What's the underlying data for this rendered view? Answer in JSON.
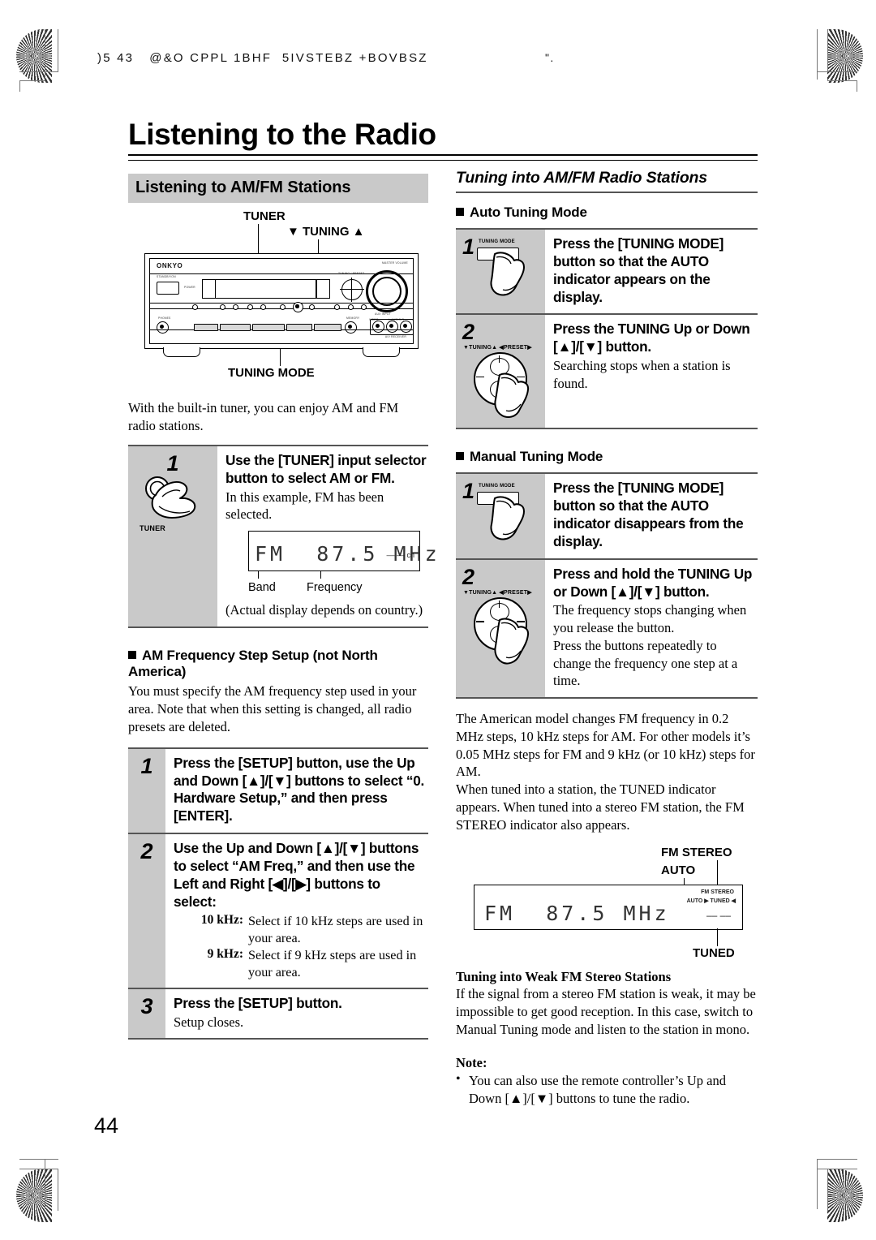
{
  "document": {
    "running_header_left": ")5 43   @&O CPPL 1BHF  5IVSTEBZ +BOVBSZ",
    "running_header_right": "\".",
    "page_number": "44",
    "title": "Listening to the Radio"
  },
  "left_column": {
    "section_heading": "Listening to AM/FM Stations",
    "figure": {
      "label_tuner": "TUNER",
      "label_tuning": "▼ TUNING ▲",
      "label_tuning_mode": "TUNING MODE",
      "brand": "ONKYO",
      "tiny_standby": "STANDBY/ON",
      "tiny_power": "POWER",
      "tiny_master_volume": "MASTER VOLUME",
      "tiny_tuning_preset": "TUNING / PRESET",
      "tiny_phones": "PHONES",
      "tiny_memory": "MEMORY",
      "tiny_aux_input": "AUX INPUT",
      "tiny_video": "VIDEO",
      "tiny_laudio": "L-AUDIO-R",
      "tiny_receiver_model": "A/V RECEIVER"
    },
    "intro_text": "With the built-in tuner, you can enjoy AM and FM radio stations.",
    "steps": [
      {
        "num": "1",
        "button_label": "TUNER",
        "bold": "Use the [TUNER] input selector button to select AM or FM.",
        "plain": "In this example, FM has been selected.",
        "display": {
          "text": "FM  87.5 MHz",
          "right_indicator": "–– –– ch",
          "label_band": "Band",
          "label_frequency": "Frequency"
        },
        "note": "(Actual display depends on country.)"
      }
    ],
    "am_setup": {
      "heading": "AM Frequency Step Setup (not North America)",
      "intro": "You must specify the AM frequency step used in your area. Note that when this setting is changed, all radio presets are deleted.",
      "steps": [
        {
          "num": "1",
          "bold": "Press the [SETUP] button, use the Up and Down [▲]/[▼] buttons to select “0. Hardware Setup,” and then press [ENTER]."
        },
        {
          "num": "2",
          "bold": "Use the Up and Down [▲]/[▼] buttons to select “AM Freq,” and then use the Left and Right [◀]/[▶] buttons to select:",
          "options": [
            {
              "key": "10 kHz:",
              "value": "Select if 10 kHz steps are used in your area."
            },
            {
              "key": "9 kHz:",
              "value": "Select if 9 kHz steps are used in your area."
            }
          ]
        },
        {
          "num": "3",
          "bold": "Press the [SETUP] button.",
          "plain": "Setup closes."
        }
      ]
    }
  },
  "right_column": {
    "section_heading": "Tuning into AM/FM Radio Stations",
    "auto_tuning": {
      "heading": "Auto Tuning Mode",
      "steps": [
        {
          "num": "1",
          "button_label": "TUNING MODE",
          "bold": "Press the [TUNING MODE] button so that the AUTO indicator appears on the display."
        },
        {
          "num": "2",
          "pad_label": "▼TUNING▲ ◀PRESET▶",
          "bold": "Press the TUNING Up or Down [▲]/[▼] button.",
          "plain": "Searching stops when a station is found."
        }
      ]
    },
    "manual_tuning": {
      "heading": "Manual Tuning Mode",
      "steps": [
        {
          "num": "1",
          "button_label": "TUNING MODE",
          "bold": "Press the [TUNING MODE] button so that the AUTO indicator disappears from the display."
        },
        {
          "num": "2",
          "pad_label": "▼TUNING▲ ◀PRESET▶",
          "bold": "Press and hold the TUNING Up or Down [▲]/[▼] button.",
          "plain": "The frequency stops changing when you release the button.",
          "plain2": "Press the buttons repeatedly to change the frequency one step at a time."
        }
      ]
    },
    "paragraph_1": "The American model changes FM frequency in 0.2 MHz steps, 10 kHz steps for AM. For other models it’s 0.05 MHz steps for FM and 9 kHz (or 10 kHz) steps for AM.",
    "paragraph_2": "When tuned into a station, the TUNED indicator appears. When tuned into a stereo FM station, the FM STEREO indicator also appears.",
    "display_figure": {
      "callout_fm_stereo": "FM STEREO",
      "callout_auto": "AUTO",
      "callout_tuned": "TUNED",
      "text": "FM  87.5 MHz",
      "right_indicator": "–– ––",
      "ind_line1": "FM STEREO",
      "ind_line2": "AUTO ▶ TUNED ◀"
    },
    "weak_stereo": {
      "heading": "Tuning into Weak FM Stereo Stations",
      "text": "If the signal from a stereo FM station is weak, it may be impossible to get good reception. In this case, switch to Manual Tuning mode and listen to the station in mono."
    },
    "note": {
      "heading": "Note:",
      "items": [
        "You can also use the remote controller’s Up and Down [▲]/[▼] buttons to tune the radio."
      ]
    }
  }
}
